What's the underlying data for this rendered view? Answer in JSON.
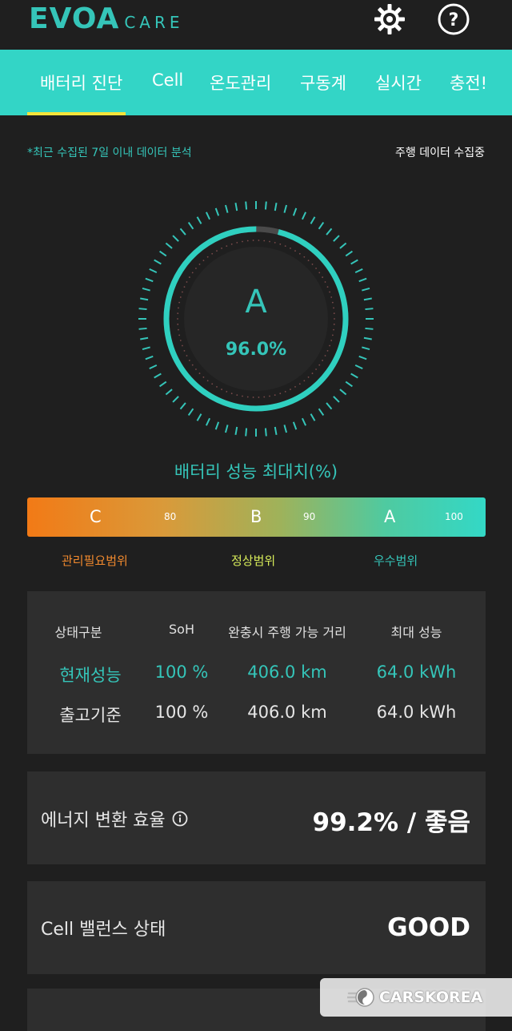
{
  "app": {
    "logo_main": "EVOA",
    "logo_sub": "CARE"
  },
  "header": {
    "settings_icon": "gear-icon",
    "help_icon": "help-icon"
  },
  "tabs": [
    {
      "label": "배터리 진단",
      "active": true
    },
    {
      "label": "Cell"
    },
    {
      "label": "온도관리"
    },
    {
      "label": "구동계"
    },
    {
      "label": "실시간"
    },
    {
      "label": "충전!"
    }
  ],
  "info": {
    "note": "*최근 수집된 7일 이내 데이터 분석",
    "collect_status": "주행 데이터 수집중"
  },
  "gauge": {
    "grade": "A",
    "percent_text": "96.0%",
    "percent": 96.0
  },
  "performance": {
    "title": "배터리 성능 최대치(%)",
    "scale_grades": [
      "C",
      "B",
      "A"
    ],
    "scale_ticks": [
      "80",
      "90",
      "100"
    ],
    "ranges": [
      {
        "label": "관리필요범위",
        "color": "#f28a2e"
      },
      {
        "label": "정상범위",
        "color": "#d8ec5a"
      },
      {
        "label": "우수범위",
        "color": "#35c5b9"
      }
    ]
  },
  "table": {
    "headers": [
      "상태구분",
      "SoH",
      "완충시 주행 가능 거리",
      "최대 성능"
    ],
    "rows": [
      [
        "현재성능",
        "100 %",
        "406.0 km",
        "64.0 kWh"
      ],
      [
        "출고기준",
        "100 %",
        "406.0 km",
        "64.0 kWh"
      ]
    ]
  },
  "efficiency": {
    "label": "에너지 변환 효율",
    "value": "99.2% / 좋음",
    "icon": "info-icon"
  },
  "cell_balance": {
    "label": "Cell 밸런스 상태",
    "value": "GOOD"
  },
  "watermark": {
    "text": "CARSKOREA"
  },
  "colors": {
    "accent": "#35c5b9",
    "tab_bar": "#33d5c6",
    "underline": "#f3e33a",
    "background": "#1f1f1f",
    "card": "#2e2e2e"
  }
}
